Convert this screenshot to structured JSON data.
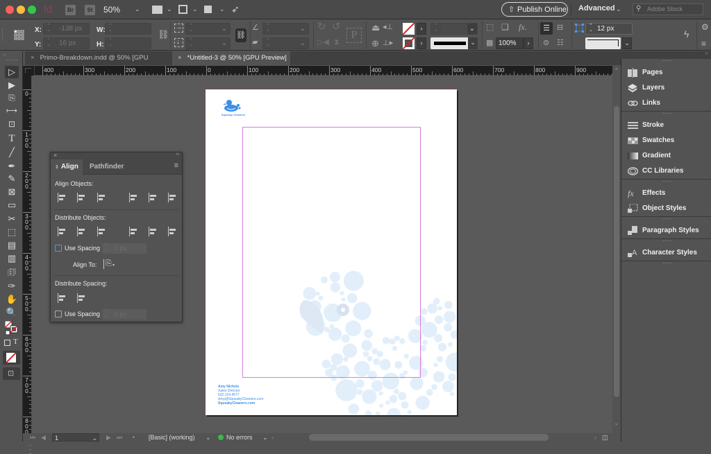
{
  "app": {
    "logo": "Id",
    "bridge_badge": "Br",
    "stock_badge": "St",
    "zoom_level": "50%",
    "publish_online": "Publish Online",
    "workspace": "Advanced",
    "search_placeholder": "Adobe Stock"
  },
  "control_bar": {
    "x_label": "X:",
    "x_value": "-138 px",
    "y_label": "Y:",
    "y_value": "16 px",
    "w_label": "W:",
    "w_value": "",
    "h_label": "H:",
    "h_value": "",
    "opacity": "100%",
    "stroke_weight": "12 px",
    "reference_point_icon": "reference-point-grid"
  },
  "tabs": [
    {
      "label": "Primo-Breakdown.indd @ 50% [GPU Preview]",
      "active": false
    },
    {
      "label": "*Untitled-3 @ 50% [GPU Preview]",
      "active": true
    }
  ],
  "rulers": {
    "horizontal": [
      "400",
      "300",
      "200",
      "100",
      "0",
      "100",
      "200",
      "300",
      "400",
      "500",
      "600",
      "700",
      "800",
      "900"
    ],
    "vertical": [
      "0",
      "100",
      "200",
      "300",
      "400",
      "500",
      "600",
      "700",
      "800"
    ]
  },
  "tools": [
    "selection",
    "direct-selection",
    "page",
    "gap",
    "content-collector",
    "type",
    "line",
    "pen",
    "pencil",
    "rectangle-frame",
    "rectangle",
    "scissors",
    "free-transform",
    "gradient-swatch",
    "gradient-feather",
    "note",
    "eyedropper",
    "hand",
    "zoom",
    "fill-stroke",
    "default-colors",
    "formatting",
    "apply-none",
    "screen-mode"
  ],
  "align_panel": {
    "tab_align": "Align",
    "tab_pathfinder": "Pathfinder",
    "align_objects": "Align Objects:",
    "distribute_objects": "Distribute Objects:",
    "use_spacing_1": "Use Spacing",
    "spacing_value_1": "0 px",
    "align_to_label": "Align To:",
    "distribute_spacing": "Distribute Spacing:",
    "use_spacing_2": "Use Spacing",
    "spacing_value_2": "0 px"
  },
  "right_panels": [
    {
      "label": "Pages",
      "icon": "pages-icon"
    },
    {
      "label": "Layers",
      "icon": "layers-icon"
    },
    {
      "label": "Links",
      "icon": "links-icon"
    },
    {
      "label": "Stroke",
      "icon": "stroke-icon"
    },
    {
      "label": "Swatches",
      "icon": "swatches-icon"
    },
    {
      "label": "Gradient",
      "icon": "gradient-icon"
    },
    {
      "label": "CC Libraries",
      "icon": "cc-libraries-icon"
    },
    {
      "label": "Effects",
      "icon": "effects-icon"
    },
    {
      "label": "Object Styles",
      "icon": "object-styles-icon"
    },
    {
      "label": "Paragraph Styles",
      "icon": "paragraph-styles-icon"
    },
    {
      "label": "Character Styles",
      "icon": "character-styles-icon"
    }
  ],
  "document": {
    "logo_text": "Squeaky Cleaners",
    "contact": {
      "name": "Amy Nichols",
      "title": "Sales Director",
      "phone": "632.124.4577",
      "email": "Amy@SqueakyCleaners.com",
      "web": "SqueakyCleaners.com"
    },
    "brand_color": "#3d8fe8",
    "margin_color": "#d67ae0"
  },
  "status_bar": {
    "page_number": "1",
    "preflight_profile": "[Basic] (working)",
    "errors": "No errors",
    "status_color": "#3cb84a"
  }
}
